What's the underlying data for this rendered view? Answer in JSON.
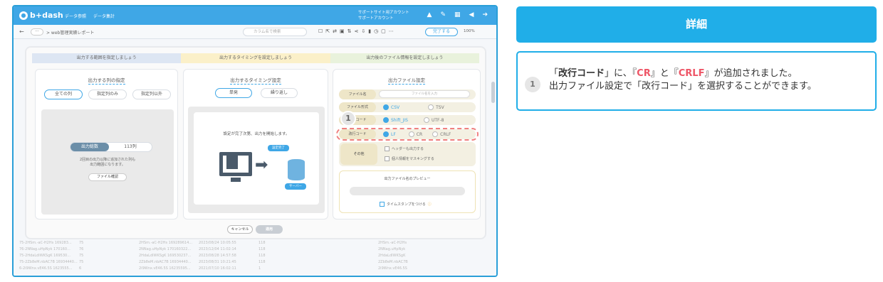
{
  "app": {
    "logo_text": "b+dash",
    "nav": [
      "データ参照",
      "データ集計"
    ],
    "account_line1": "サポートサイト用アカウント",
    "account_line2": "サポートアカウント"
  },
  "toolbar": {
    "back": "←",
    "more": "···",
    "breadcrumb": "> web管理実績レポート",
    "search_placeholder": "カラム名で検索",
    "done_label": "完了する",
    "zoom": "100%"
  },
  "steps": [
    "出力する範囲を指定しましょう",
    "出力するタイミングを設定しましょう",
    "出力後のファイル情報を設定しましょう"
  ],
  "panel_columns": {
    "title": "出力する列の指定",
    "options": [
      "全ての列",
      "指定列のみ",
      "指定列以外"
    ],
    "count_label": "出力総数",
    "count_value": "113列",
    "note_line1": "2回目の出力以降に追加された列も",
    "note_line2": "出力範囲になります。",
    "file_button": "ファイル確認"
  },
  "panel_timing": {
    "title": "出力するタイミング設定",
    "options": [
      "単発",
      "繰り返し"
    ],
    "message": "設定が完了次第、出力を開始します。",
    "badge_done": "設定完了",
    "badge_server": "サーバー"
  },
  "panel_file": {
    "title": "出力ファイル設定",
    "filename_label": "ファイル名",
    "filename_placeholder": "ファイル名を入力",
    "format_label": "ファイル形式",
    "format_options": [
      "CSV",
      "TSV"
    ],
    "encoding_label": "文字コード",
    "encoding_options": [
      "Shift_JIS",
      "UTF-8"
    ],
    "newline_label": "改行コード",
    "newline_options": [
      "LF",
      "CR",
      "CRLF"
    ],
    "other_label": "その他",
    "other_options": [
      "ヘッダーも出力する",
      "個人情報をマスキングする"
    ],
    "preview_title": "出力ファイル名のプレビュー",
    "timestamp_label": "タイムスタンプをつける"
  },
  "footer": {
    "cancel": "キャンセル",
    "apply": "適用"
  },
  "callout_marker": "1",
  "bg_rows": [
    [
      "75-2HSm.-aC-H2Hs 169283...",
      "75",
      "2HSm.-aC-H2Hs 169289614...",
      "2023/08/24 10:05:55",
      "118",
      "",
      "2HSm.-aC-H2Hs"
    ],
    [
      "76-2NNag.uHpNyk 170160...",
      "76",
      "2NNag.uHpNyk 170160322...",
      "2023/12/04 11:02:14",
      "118",
      "",
      "2NNag.uHpNyk"
    ],
    [
      "75-2HdaLdlWKSgK 169530...",
      "75",
      "2HdaLdlWKSgK 169530237...",
      "2023/08/28 14:57:58",
      "118",
      "",
      "2HdaLdlWKSgK"
    ],
    [
      "75-2Zb8eM.nbAC7B 16934440...",
      "75",
      "2Zb8eM.nbAC7B 16934440...",
      "2023/08/31 10:21:45",
      "118",
      "",
      "2Zb8eM.nbAC7B"
    ],
    [
      "6-2i9Wnx.vE46.5S 1623555...",
      "6",
      "2i9Wnx.vE46.5S 16235595...",
      "2021/07/10 16:02:11",
      "1",
      "",
      "2i9Wnx.vE46.5S"
    ]
  ],
  "detail": {
    "header": "詳細",
    "number": "1",
    "line1_a": "「",
    "line1_b": "改行コード",
    "line1_c": "」に、『",
    "line1_d": "CR",
    "line1_e": "』と『",
    "line1_f": "CRLF",
    "line1_g": "』が追加されました。",
    "line2": "出力ファイル設定で「改行コード」を選択することができます。"
  },
  "colors": {
    "accent": "#20aee8",
    "highlight": "#ee5566"
  }
}
